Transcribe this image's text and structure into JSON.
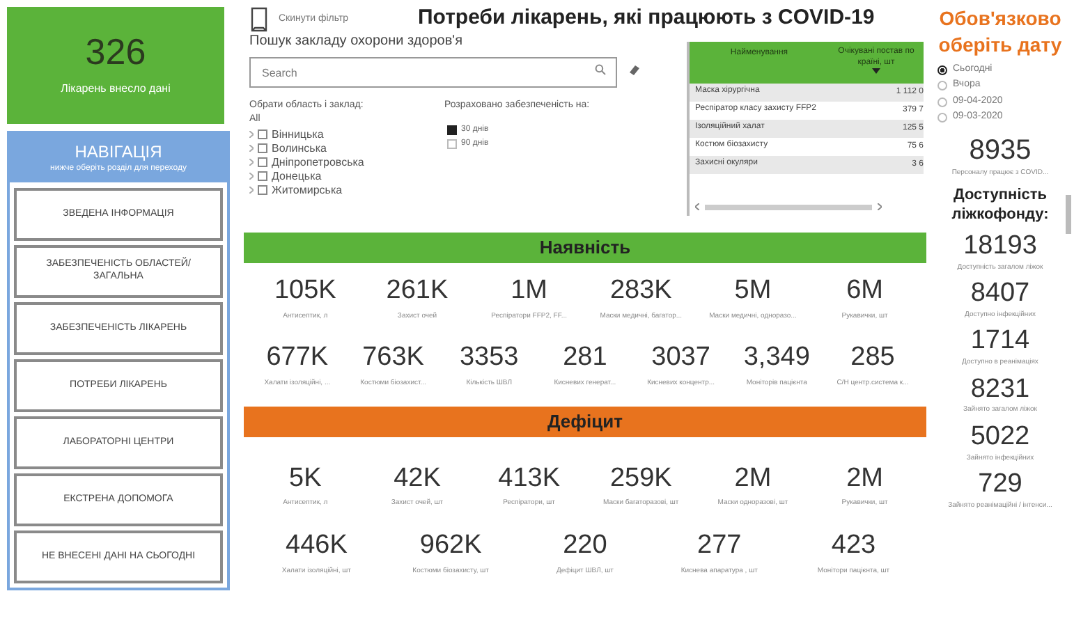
{
  "hospitals_card": {
    "value": "326",
    "label": "Лікарень внесло дані"
  },
  "navigation": {
    "title": "НАВІГАЦІЯ",
    "subtitle": "нижче оберіть розділ для переходу",
    "items": [
      {
        "label": "ЗВЕДЕНА ІНФОРМАЦІЯ"
      },
      {
        "label": "ЗАБЕЗПЕЧЕНІСТЬ ОБЛАСТЕЙ/ ЗАГАЛЬНА"
      },
      {
        "label": "ЗАБЕЗПЕЧЕНІСТЬ ЛІКАРЕНЬ"
      },
      {
        "label": "ПОТРЕБИ ЛІКАРЕНЬ"
      },
      {
        "label": "ЛАБОРАТОРНІ ЦЕНТРИ"
      },
      {
        "label": "ЕКСТРЕНА ДОПОМОГА"
      },
      {
        "label": "НЕ ВНЕСЕНІ ДАНІ НА СЬОГОДНІ"
      }
    ]
  },
  "reset_filter": "Скинути фільтр",
  "title": "Потреби лікарень, які працюють з COVID-19",
  "search": {
    "label": "Пошук закладу охорони здоров'я",
    "placeholder": "Search"
  },
  "region_filter": {
    "label": "Обрати область і заклад:",
    "all": "All",
    "items": [
      {
        "label": "Вінницька",
        "checked": false
      },
      {
        "label": "Волинська",
        "checked": false
      },
      {
        "label": "Дніпропетровська",
        "checked": false
      },
      {
        "label": "Донецька",
        "checked": false
      },
      {
        "label": "Житомирська",
        "checked": false
      }
    ]
  },
  "days_filter": {
    "label": "Розраховано забезпеченість на:",
    "options": [
      {
        "label": "30 днів",
        "selected": true
      },
      {
        "label": "90 днів",
        "selected": false
      }
    ]
  },
  "table": {
    "columns": [
      "Найменування",
      "Очікувані постав по країні, шт"
    ],
    "rows": [
      [
        "Маска хірургічна",
        "1 112 0"
      ],
      [
        "Респіратор класу захисту FFP2",
        "379 7"
      ],
      [
        "Ізоляційний халат",
        "125 5"
      ],
      [
        "Костюм біозахисту",
        "75 6"
      ],
      [
        "Захисні окуляри",
        "3 6"
      ]
    ]
  },
  "availability": {
    "title": "Наявність",
    "rows": [
      {
        "items": [
          {
            "value": "105K",
            "label": "Антисептик, л"
          },
          {
            "value": "261K",
            "label": "Захист очей"
          },
          {
            "value": "1M",
            "label": "Респіратори FFP2, FF..."
          },
          {
            "value": "283K",
            "label": "Маски медичні, багатор..."
          },
          {
            "value": "5M",
            "label": "Маски медичні, одноразо..."
          },
          {
            "value": "6M",
            "label": "Рукавички, шт"
          }
        ]
      },
      {
        "items": [
          {
            "value": "677K",
            "label": "Халати ізоляційні, ..."
          },
          {
            "value": "763K",
            "label": "Костюми біозахист..."
          },
          {
            "value": "3353",
            "label": "Кількість ШВЛ"
          },
          {
            "value": "281",
            "label": "Кисневих генерат..."
          },
          {
            "value": "3037",
            "label": "Кисневих концентр..."
          },
          {
            "value": "3,349",
            "label": "Моніторів пацієнта"
          },
          {
            "value": "285",
            "label": "С/Н центр.система к..."
          }
        ]
      }
    ]
  },
  "deficit": {
    "title": "Дефіцит",
    "rows": [
      {
        "items": [
          {
            "value": "5K",
            "label": "Антисептик, л"
          },
          {
            "value": "42K",
            "label": "Захист очей, шт"
          },
          {
            "value": "413K",
            "label": "Респіратори, шт"
          },
          {
            "value": "259K",
            "label": "Маски багаторазові, шт"
          },
          {
            "value": "2M",
            "label": "Маски одноразові, шт"
          },
          {
            "value": "2M",
            "label": "Рукавички, шт"
          }
        ]
      },
      {
        "items": [
          {
            "value": "446K",
            "label": "Халати ізоляційні, шт"
          },
          {
            "value": "962K",
            "label": "Костюми біозахисту, шт"
          },
          {
            "value": "220",
            "label": "Дефіцит ШВЛ, шт"
          },
          {
            "value": "277",
            "label": "Киснева апаратура , шт"
          },
          {
            "value": "423",
            "label": "Монітори пацієнта, шт"
          }
        ]
      }
    ]
  },
  "date_picker": {
    "title": "Обов'язково оберіть дату",
    "options": [
      {
        "label": "Сьогодні",
        "selected": true
      },
      {
        "label": "Вчора",
        "selected": false
      },
      {
        "label": "09-04-2020",
        "selected": false
      },
      {
        "label": "09-03-2020",
        "selected": false
      }
    ]
  },
  "staff": {
    "value": "8935",
    "label": "Персоналу працює з COVID..."
  },
  "beds": {
    "title": "Доступність ліжкофонду:",
    "items": [
      {
        "value": "18193",
        "label": "Доступність загалом ліжок"
      },
      {
        "value": "8407",
        "label": "Доступно інфекційних"
      },
      {
        "value": "1714",
        "label": "Доступно в реанімаціях"
      },
      {
        "value": "8231",
        "label": "Зайнято загалом ліжок"
      },
      {
        "value": "5022",
        "label": "Зайнято інфекційних"
      },
      {
        "value": "729",
        "label": "Зайнято реанімаційні / інтенси..."
      }
    ]
  }
}
